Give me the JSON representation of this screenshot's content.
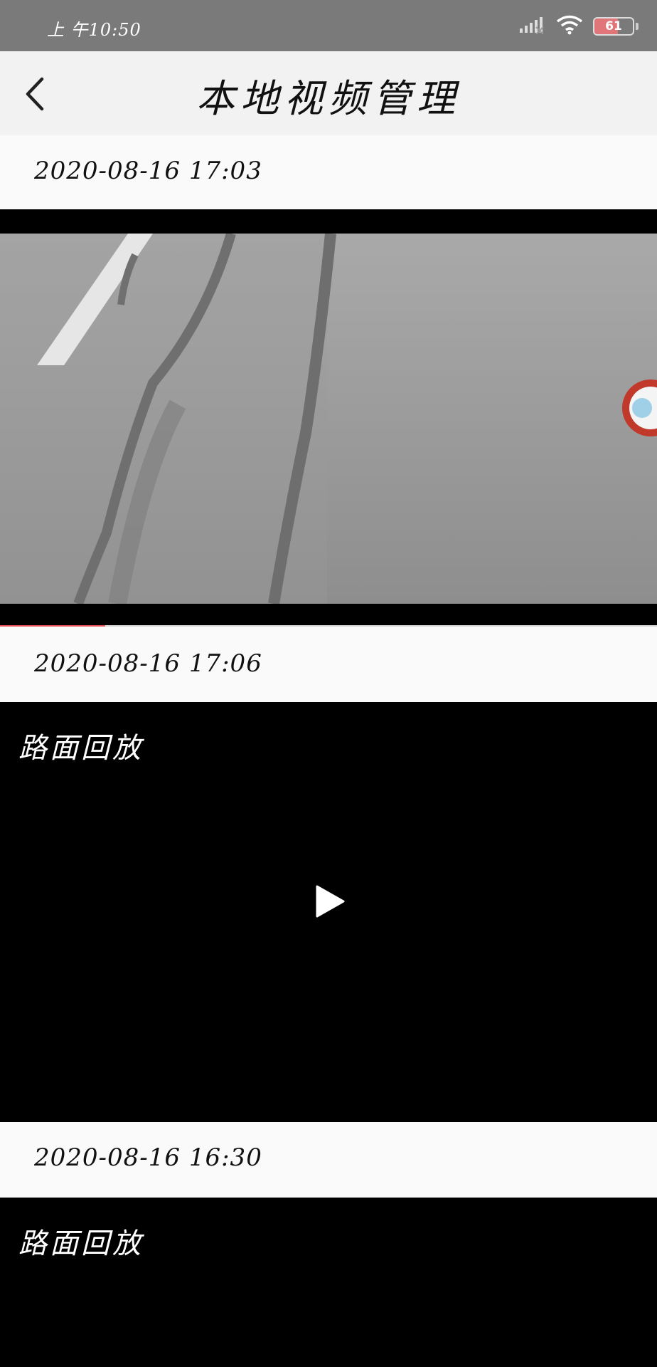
{
  "status_bar": {
    "time": "上 午10:50",
    "battery_level": "61",
    "icons": [
      "signal-icon",
      "wifi-icon",
      "battery-icon"
    ]
  },
  "header": {
    "title": "本地视频管理",
    "back_icon": "chevron-left-icon"
  },
  "videos": [
    {
      "date": "2020-08-16 17:03",
      "state": "playing",
      "progress_fraction": 0.16
    },
    {
      "date": "2020-08-16 17:06",
      "caption": "路面回放",
      "state": "paused",
      "play_icon": "play-icon"
    },
    {
      "date": "2020-08-16 16:30",
      "caption": "路面回放"
    }
  ],
  "colors": {
    "status_bar_bg": "#7a7a7a",
    "header_bg": "#f2f2f2",
    "row_bg": "#fafafa",
    "progress_accent": "#e5484d"
  }
}
